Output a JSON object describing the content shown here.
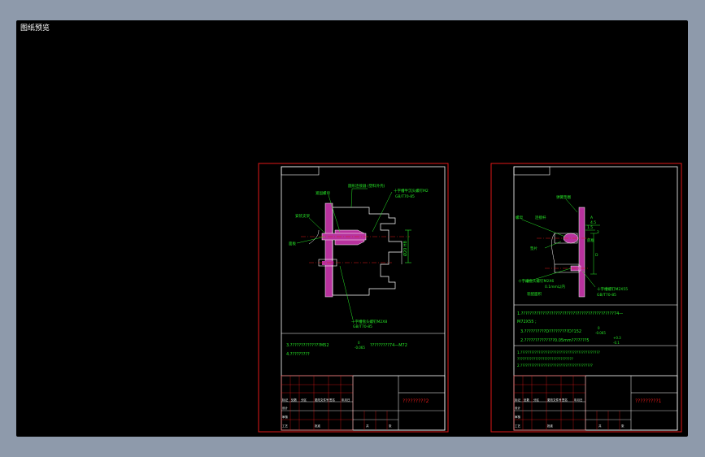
{
  "viewer": {
    "title": "图纸预览"
  },
  "drawing_a": {
    "callouts": [
      "圆形连接器 (塑料外壳)",
      "十字槽半沉头螺钉M2",
      "GB/T70-85",
      "紧固螺母",
      "安装支架",
      "面板",
      "十字槽盘头螺钉M2X8",
      "GB/T70-85"
    ],
    "dim_vertical": "Ø20 H8",
    "note_line1": "3.??????????????M52",
    "note_tol": "0",
    "note_tol2": "-0.065",
    "note_extra": "?????????74—M72",
    "note_line2": "4.?????????",
    "title_box": "?????????2",
    "table_top_cells": [
      "标记",
      "处数",
      "分区",
      "更改文件号",
      "签名",
      "年月日"
    ],
    "table_bottom_cells": [
      "设计",
      "审核",
      "工艺",
      "批准",
      "共",
      "张"
    ]
  },
  "drawing_b": {
    "callouts": [
      "弹簧垫圈",
      "A",
      "4.5",
      "螺母",
      "连接杆",
      "垫片",
      "底板",
      "D",
      "1.5",
      "2",
      "十字槽盘头螺钉M2X6",
      "0.1mm以内",
      "装配面积",
      "十字槽螺钉M2X55",
      "GB/T70-85"
    ],
    "note_line1": "1.???????????????????????????????????????????74—",
    "note_line1b": "M72X55 ;",
    "note_line2": "3.??????????D?????????D?152",
    "note_tol": "0",
    "note_tol2": "-0.065",
    "note_line3": "2.??????????????0.05mm???????5",
    "note_tol3": "+0.3",
    "note_tol4": "-0.1",
    "note_block": [
      "1.????????????????????????????????????????????",
      "???????????????????????????????",
      "2.????????????????????????????????????????"
    ],
    "title_box": "?????????1",
    "table_top_cells": [
      "标记",
      "处数",
      "分区",
      "更改文件号",
      "签名",
      "年月日"
    ],
    "table_bottom_cells": [
      "设计",
      "审核",
      "工艺",
      "批准",
      "共",
      "张"
    ]
  },
  "colors": {
    "frame": "#e01818",
    "sheet_line": "#ffffff",
    "annotation": "#27e827",
    "part_fill": "#b8329e",
    "centerline": "#e01818",
    "hatch": "#ffffff"
  }
}
